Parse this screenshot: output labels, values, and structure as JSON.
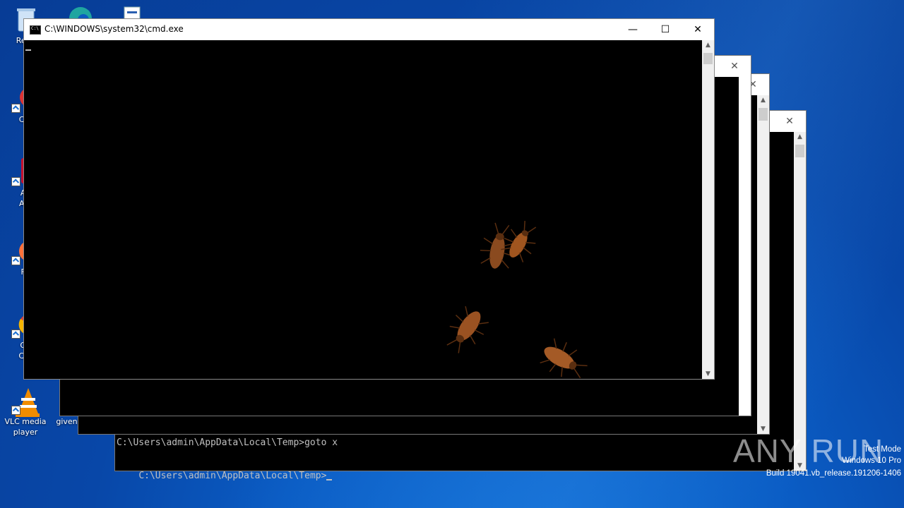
{
  "desktop": {
    "icons": [
      {
        "label": "Recy",
        "icon": "recycle-bin-icon"
      },
      {
        "label": "CCl",
        "icon": "ccleaner-icon"
      },
      {
        "label": "Ad",
        "label2": "Acr",
        "icon": "acrobat-icon"
      },
      {
        "label": "Fir",
        "icon": "firefox-icon"
      },
      {
        "label": "Go",
        "label2": "Chr",
        "icon": "chrome-icon"
      },
      {
        "label": "VLC media",
        "label2": "player",
        "icon": "vlc-icon"
      },
      {
        "label": "givenh",
        "icon": "file-icon"
      }
    ]
  },
  "main_window": {
    "title": "C:\\WINDOWS\\system32\\cmd.exe",
    "minimize": "—",
    "maximize": "☐",
    "close": "✕"
  },
  "back_window": {
    "line1": "C:\\Users\\admin\\AppData\\Local\\Temp>goto x",
    "line2": "C:\\Users\\admin\\AppData\\Local\\Temp>"
  },
  "watermark": {
    "brand": "ANY RUN",
    "mode": "Test Mode",
    "os": "Windows 10 Pro",
    "build": "Build 19041.vb_release.191206-1406"
  },
  "colors": {
    "console_bg": "#000000",
    "console_fg": "#c0c0c0",
    "roach": "#8a4a1f"
  }
}
